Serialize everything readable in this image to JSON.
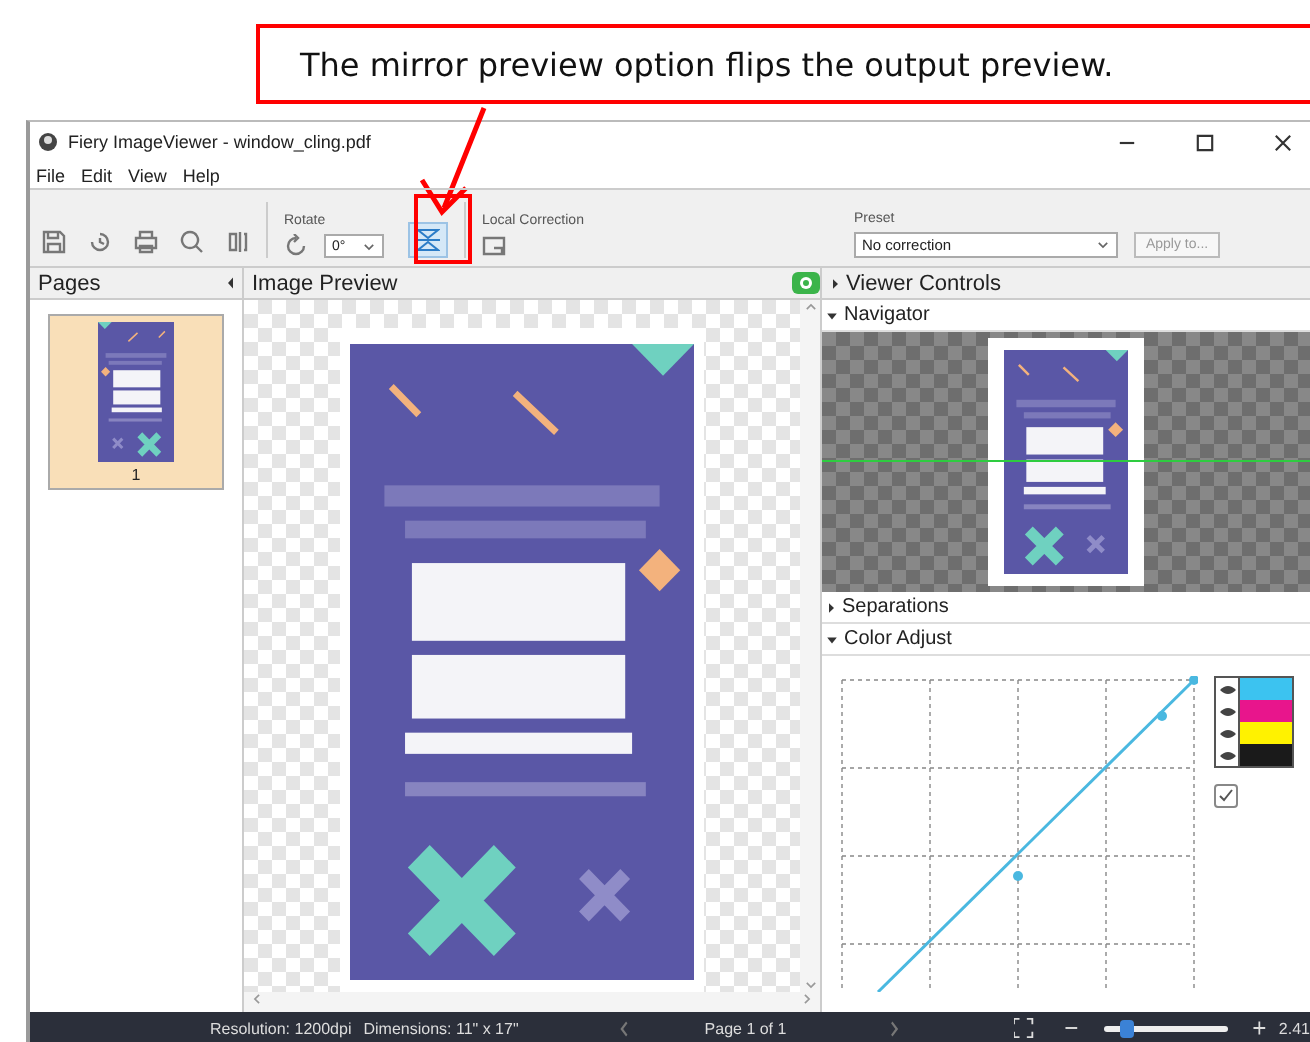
{
  "callout": {
    "text": "The mirror preview option flips the output preview."
  },
  "window": {
    "title": "Fiery ImageViewer - window_cling.pdf"
  },
  "menu": [
    "File",
    "Edit",
    "View",
    "Help"
  ],
  "toolbar": {
    "rotate_label": "Rotate",
    "rotate_value": "0°",
    "mirror": {
      "selected": true
    },
    "local_correction_label": "Local Correction",
    "preset_label": "Preset",
    "preset_value": "No correction",
    "apply_button": {
      "label": "Apply to...",
      "disabled": true
    }
  },
  "pages_panel": {
    "title": "Pages",
    "pages": [
      {
        "number": "1",
        "selected": true
      }
    ]
  },
  "preview": {
    "title": "Image Preview"
  },
  "viewer_controls": {
    "title": "Viewer Controls",
    "sections": [
      {
        "title": "Navigator",
        "kind": "navigator",
        "expanded": true
      },
      {
        "title": "Separations",
        "kind": "separations",
        "expanded": false
      },
      {
        "title": "Color Adjust",
        "kind": "color_adjust",
        "expanded": true
      }
    ]
  },
  "channels": [
    {
      "color": "#3cc3f0",
      "visible": true
    },
    {
      "color": "#e8158c",
      "visible": true
    },
    {
      "color": "#fff200",
      "visible": true
    },
    {
      "color": "#1a1a1a",
      "visible": true
    }
  ],
  "show_all": {
    "checked": true
  },
  "status_bar": {
    "resolution": "Resolution: 1200dpi",
    "dimensions": "Dimensions: 11\" x 17\"",
    "page": "Page 1 of 1",
    "zoom": {
      "level": 0.18
    },
    "zoom_text": "2.41"
  }
}
